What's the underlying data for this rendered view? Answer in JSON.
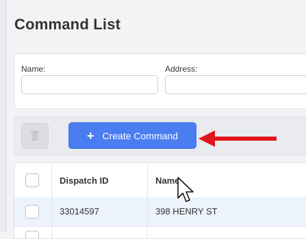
{
  "page": {
    "title": "Command List"
  },
  "filters": {
    "name_label": "Name:",
    "name_value": "",
    "address_label": "Address:",
    "address_value": ""
  },
  "toolbar": {
    "delete_icon": "trash-icon",
    "create_label": "Create Command",
    "create_icon": "plus-icon"
  },
  "annotation": {
    "arrow_color": "#e0141b"
  },
  "table": {
    "headers": {
      "dispatch_id": "Dispatch ID",
      "name": "Name"
    },
    "rows": [
      {
        "dispatch_id": "33014597",
        "name": "398 HENRY ST",
        "selected": false
      }
    ]
  },
  "colors": {
    "primary": "#4a7df0",
    "row_highlight": "#edf3fd"
  }
}
